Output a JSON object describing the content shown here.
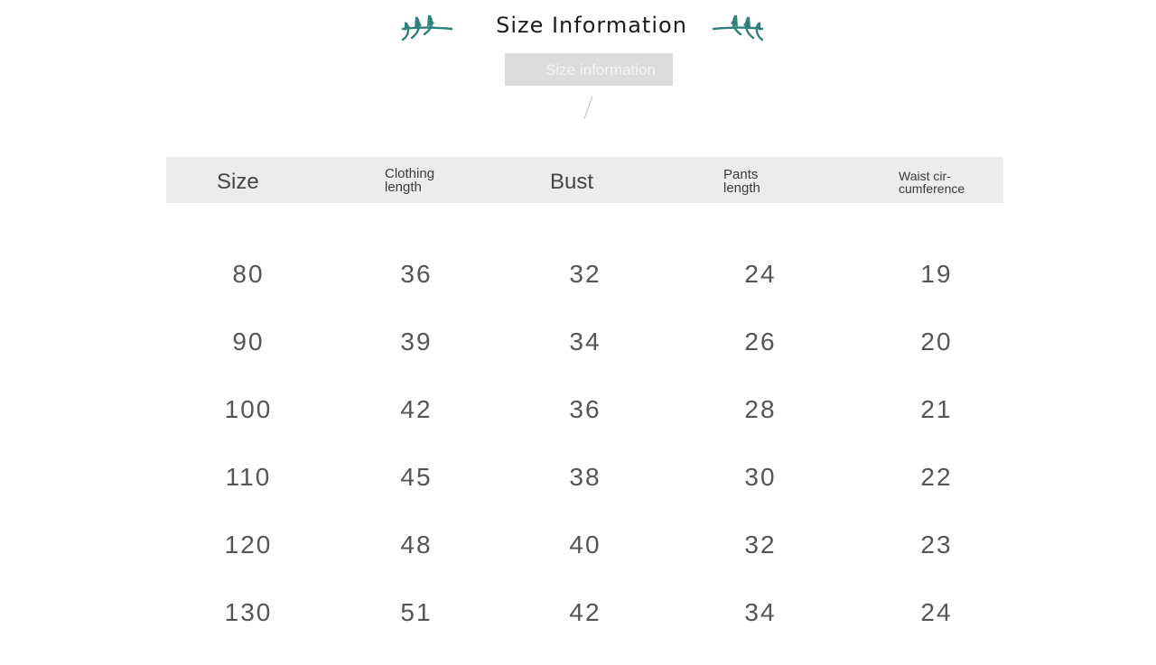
{
  "header": {
    "title": "Size Information",
    "subtitle": "Size information"
  },
  "table": {
    "columns": [
      "Size",
      "Clothing\nlength",
      "Bust",
      "Pants\nlength",
      "Waist cir-\ncumference"
    ],
    "rows": [
      [
        "80",
        "36",
        "32",
        "24",
        "19"
      ],
      [
        "90",
        "39",
        "34",
        "26",
        "20"
      ],
      [
        "100",
        "42",
        "36",
        "28",
        "21"
      ],
      [
        "110",
        "45",
        "38",
        "30",
        "22"
      ],
      [
        "120",
        "48",
        "40",
        "32",
        "23"
      ],
      [
        "130",
        "51",
        "42",
        "34",
        "24"
      ]
    ]
  },
  "colors": {
    "leaf": "#2f7f7a",
    "header_bar": "#ececec",
    "subtitle_box": "#dcdcdc",
    "text": "#555555"
  },
  "icons": [
    "leaf-left-icon",
    "leaf-right-icon"
  ]
}
